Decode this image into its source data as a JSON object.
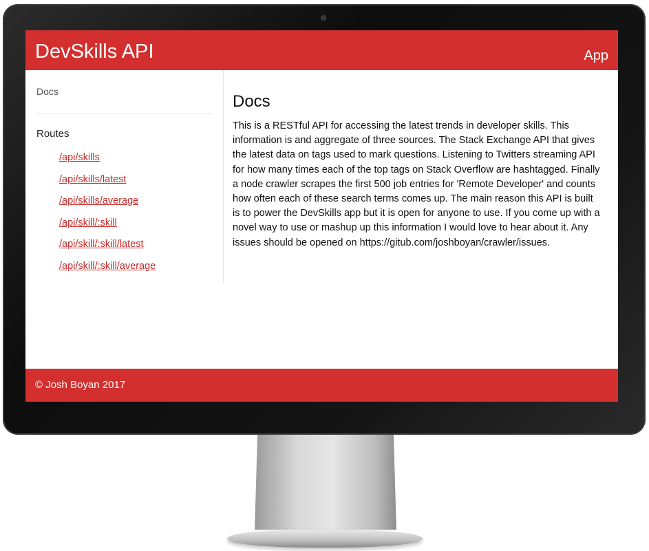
{
  "header": {
    "brand": "DevSkills API",
    "nav_app": "App"
  },
  "sidebar": {
    "docs_link": "Docs",
    "routes_heading": "Routes",
    "routes": [
      "/api/skills",
      "/api/skills/latest",
      "/api/skills/average",
      "/api/skill/:skill",
      "/api/skill/:skill/latest",
      "/api/skill/:skill/average"
    ]
  },
  "main": {
    "title": "Docs",
    "body": "This is a RESTful API for accessing the latest trends in developer skills. This information is and aggregate of three sources. The Stack Exchange API that gives the latest data on tags used to mark questions. Listening to Twitters streaming API for how many times each of the top tags on Stack Overflow are hashtagged. Finally a node crawler scrapes the first 500 job entries for 'Remote Developer' and counts how often each of these search terms comes up. The main reason this API is built is to power the DevSkills app but it is open for anyone to use. If you come up with a novel way to use or mashup up this information I would love to hear about it. Any issues should be opened on https://gitub.com/joshboyan/crawler/issues."
  },
  "footer": {
    "text": "© Josh Boyan 2017"
  },
  "colors": {
    "accent": "#d32f2f",
    "link": "#c62828"
  }
}
